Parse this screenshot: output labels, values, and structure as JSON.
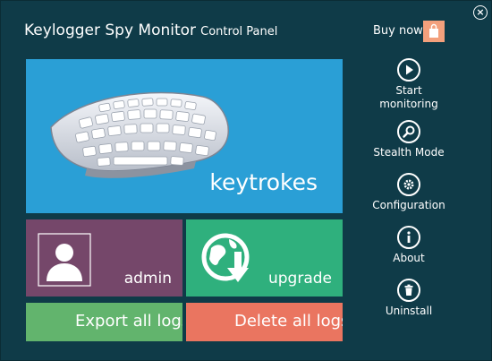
{
  "window": {
    "title_main": "Keylogger Spy Monitor",
    "title_sub": "Control Panel",
    "close_label": "×"
  },
  "header": {
    "buy_now_label": "Buy now",
    "buy_icon": "shopping-bag-icon"
  },
  "tiles": {
    "keystrokes_label": "keytrokes",
    "admin_label": "admin",
    "upgrade_label": "upgrade",
    "export_label": "Export all logs",
    "delete_label": "Delete all logs"
  },
  "sidebar": {
    "items": [
      {
        "label_line1": "Start",
        "label_line2": "monitoring",
        "icon": "play-icon"
      },
      {
        "label_line1": "Stealth Mode",
        "label_line2": "",
        "icon": "magnifier-icon"
      },
      {
        "label_line1": "Configuration",
        "label_line2": "",
        "icon": "gear-icon"
      },
      {
        "label_line1": "About",
        "label_line2": "",
        "icon": "info-icon"
      },
      {
        "label_line1": "Uninstall",
        "label_line2": "",
        "icon": "trash-icon"
      }
    ]
  },
  "colors": {
    "background": "#0f3b48",
    "keystrokes_tile": "#2a9fd6",
    "admin_tile": "#75476a",
    "upgrade_tile": "#2fb07d",
    "export_tile": "#62b46d",
    "delete_tile": "#ea7560",
    "buy_icon": "#f3a07c"
  }
}
